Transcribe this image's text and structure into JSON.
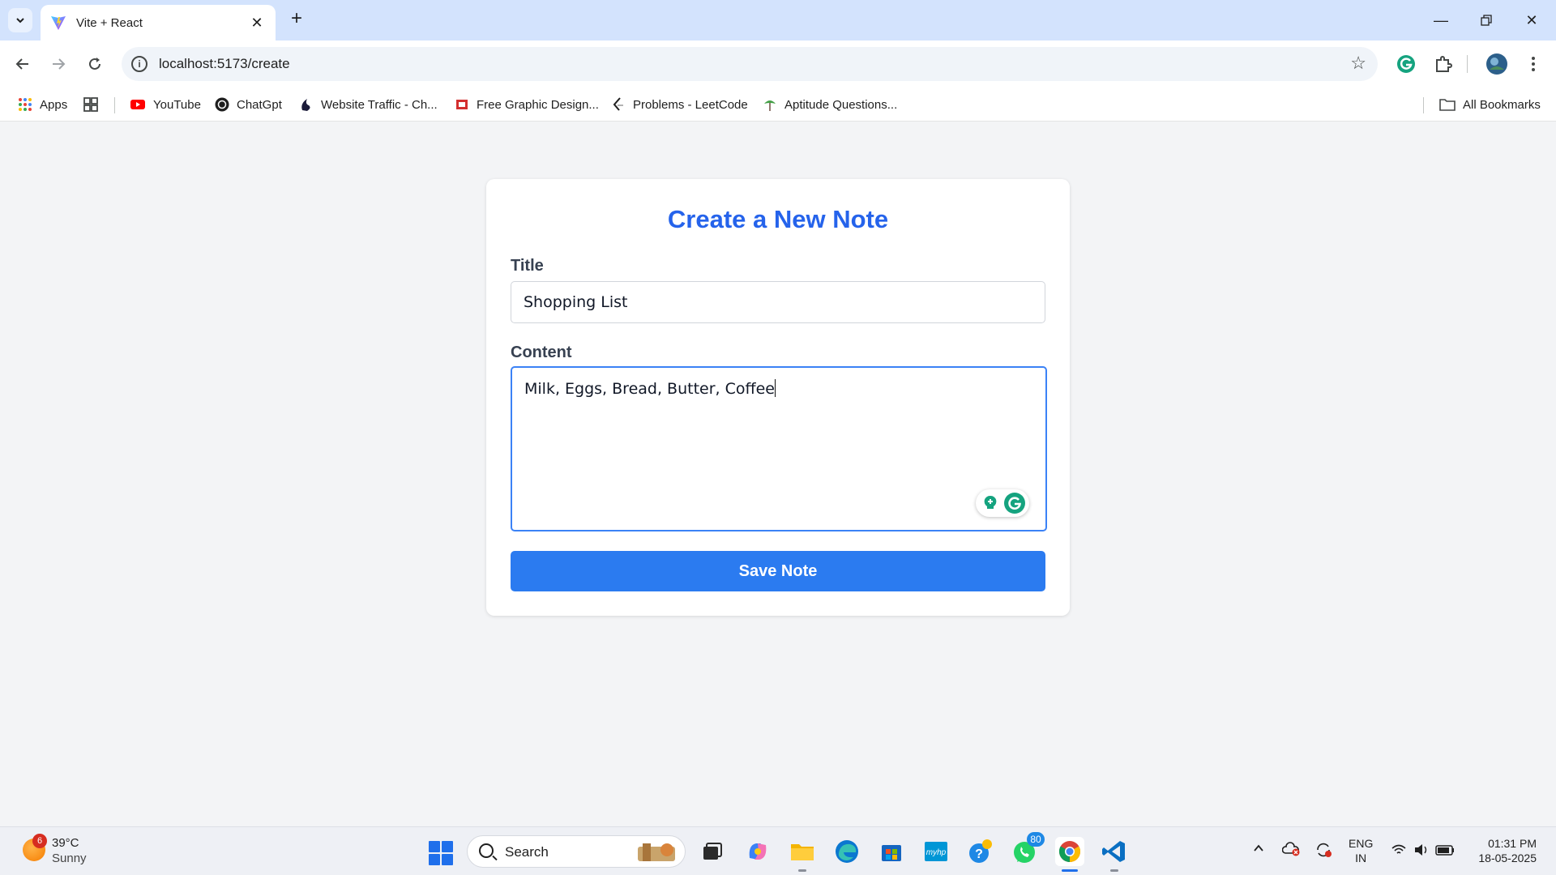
{
  "browser": {
    "tab_title": "Vite + React",
    "url": "localhost:5173/create",
    "bookmarks": [
      {
        "label": "Apps",
        "icon": "apps-grid-icon"
      },
      {
        "label": "YouTube",
        "icon": "youtube-icon"
      },
      {
        "label": "ChatGpt",
        "icon": "chatgpt-icon"
      },
      {
        "label": "Website Traffic - Ch...",
        "icon": "similarweb-icon"
      },
      {
        "label": "Free Graphic Design...",
        "icon": "graphic-design-icon"
      },
      {
        "label": "Problems - LeetCode",
        "icon": "leetcode-icon"
      },
      {
        "label": "Aptitude Questions...",
        "icon": "aptitude-icon"
      }
    ],
    "all_bookmarks": "All Bookmarks"
  },
  "form": {
    "heading": "Create a New Note",
    "title_label": "Title",
    "title_value": "Shopping List",
    "content_label": "Content",
    "content_value": "Milk, Eggs, Bread, Butter, Coffee",
    "save_label": "Save Note"
  },
  "taskbar": {
    "weather_badge": "6",
    "weather_temp": "39°C",
    "weather_desc": "Sunny",
    "search_placeholder": "Search",
    "whatsapp_badge": "80",
    "lang_top": "ENG",
    "lang_bottom": "IN",
    "time": "01:31 PM",
    "date": "18-05-2025"
  },
  "colors": {
    "accent": "#2563eb",
    "button": "#2b7bf0",
    "focus_border": "#3b82f6",
    "tabstrip": "#d3e3fd"
  }
}
